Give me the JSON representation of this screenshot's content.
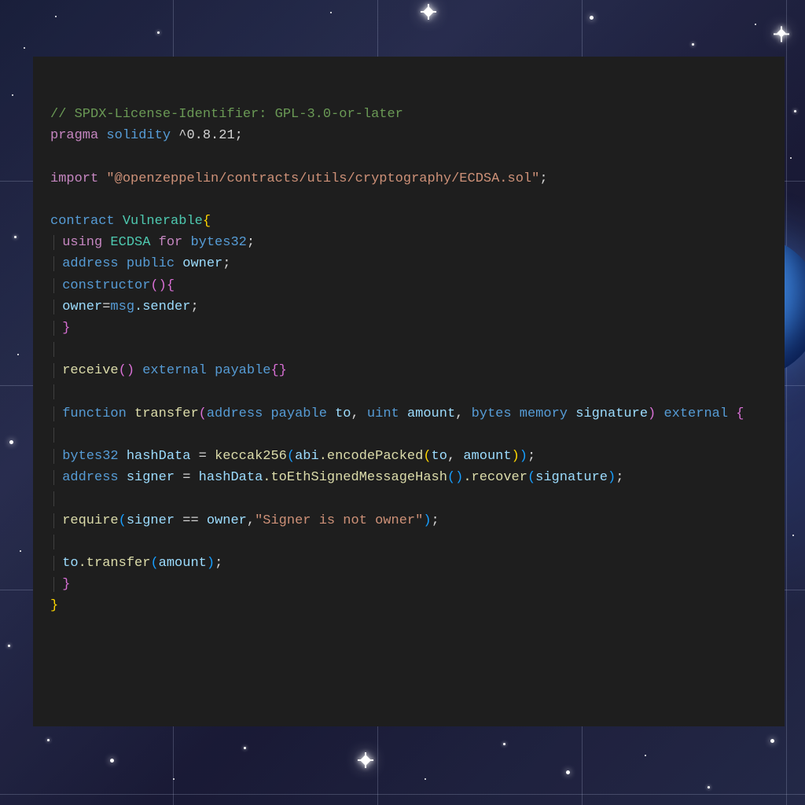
{
  "code": {
    "license": "// SPDX-License-Identifier: GPL-3.0-or-later",
    "pragma_kw": "pragma",
    "pragma_sol": "solidity",
    "pragma_ver": "^0.8.21",
    "import_kw": "import",
    "import_path": "\"@openzeppelin/contracts/utils/cryptography/ECDSA.sol\"",
    "contract_kw": "contract",
    "contract_name": "Vulnerable",
    "using_kw": "using",
    "ecdsa": "ECDSA",
    "for_kw": "for",
    "bytes32": "bytes32",
    "address": "address",
    "public_kw": "public",
    "owner_var": "owner",
    "constructor_kw": "constructor",
    "owner_assign": "owner",
    "msg": "msg",
    "sender": ".sender",
    "receive_kw": "receive",
    "external_kw": "external",
    "payable_kw": "payable",
    "function_kw": "function",
    "transfer_fn": "transfer",
    "to_param": "to",
    "uint": "uint",
    "amount_param": "amount",
    "bytes": "bytes",
    "memory_kw": "memory",
    "signature_param": "signature",
    "hashData": "hashData",
    "keccak": "keccak256",
    "abi": "abi",
    "encodePacked": ".encodePacked",
    "signer_var": "signer",
    "toEth": ".toEthSignedMessageHash",
    "recover": ".recover",
    "require_kw": "require",
    "eq": "==",
    "err_msg": "\"Signer is not owner\"",
    "transfer_call": ".transfer"
  }
}
